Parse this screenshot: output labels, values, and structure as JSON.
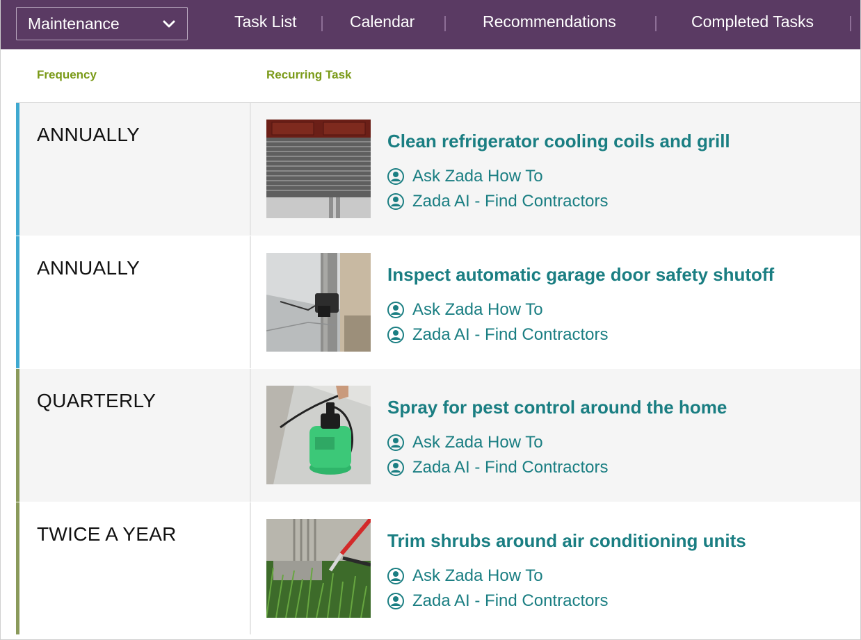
{
  "nav": {
    "dropdown_label": "Maintenance",
    "tabs": [
      {
        "label": "Task List"
      },
      {
        "label": "Calendar"
      },
      {
        "label": "Recommendations"
      },
      {
        "label": "Completed Tasks"
      }
    ]
  },
  "table": {
    "headers": {
      "frequency": "Frequency",
      "task": "Recurring Task"
    },
    "rows": [
      {
        "frequency": "ANNUALLY",
        "title": "Clean refrigerator cooling coils and grill",
        "link_howto": "Ask Zada How To",
        "link_contractors": "Zada AI - Find Contractors",
        "accent_color": "#3fa9d0",
        "image": "refrigerator-grill-photo"
      },
      {
        "frequency": "ANNUALLY",
        "title": "Inspect automatic garage door safety shutoff",
        "link_howto": "Ask Zada How To",
        "link_contractors": "Zada AI - Find Contractors",
        "accent_color": "#3fa9d0",
        "image": "garage-door-sensor-photo"
      },
      {
        "frequency": "QUARTERLY",
        "title": "Spray for pest control around the home",
        "link_howto": "Ask Zada How To",
        "link_contractors": "Zada AI - Find Contractors",
        "accent_color": "#8a9a5b",
        "image": "pest-sprayer-photo"
      },
      {
        "frequency": "TWICE A YEAR",
        "title": "Trim shrubs around air conditioning units",
        "link_howto": "Ask Zada How To",
        "link_contractors": "Zada AI - Find Contractors",
        "accent_color": "#8a9a5b",
        "image": "shrub-trimming-photo"
      }
    ]
  },
  "colors": {
    "nav_bg": "#5a3a63",
    "header_green": "#7a9a18",
    "link_teal": "#1a7e82",
    "row_alt_bg": "#f5f5f5"
  },
  "icons": {
    "dropdown": "chevron-down-icon",
    "link": "user-circle-icon"
  }
}
